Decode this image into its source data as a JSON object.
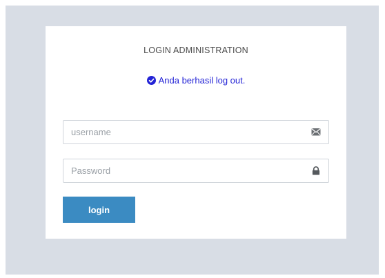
{
  "login": {
    "title": "LOGIN ADMINISTRATION",
    "alert_message": "Anda berhasil log out.",
    "alert_icon": "check-circle-icon",
    "alert_color": "#2424d6",
    "username": {
      "placeholder": "username",
      "value": "",
      "icon": "envelope-icon"
    },
    "password": {
      "placeholder": "Password",
      "value": "",
      "icon": "lock-icon"
    },
    "submit_label": "login",
    "button_color": "#3b8bc2",
    "background_color": "#d8dde5"
  }
}
